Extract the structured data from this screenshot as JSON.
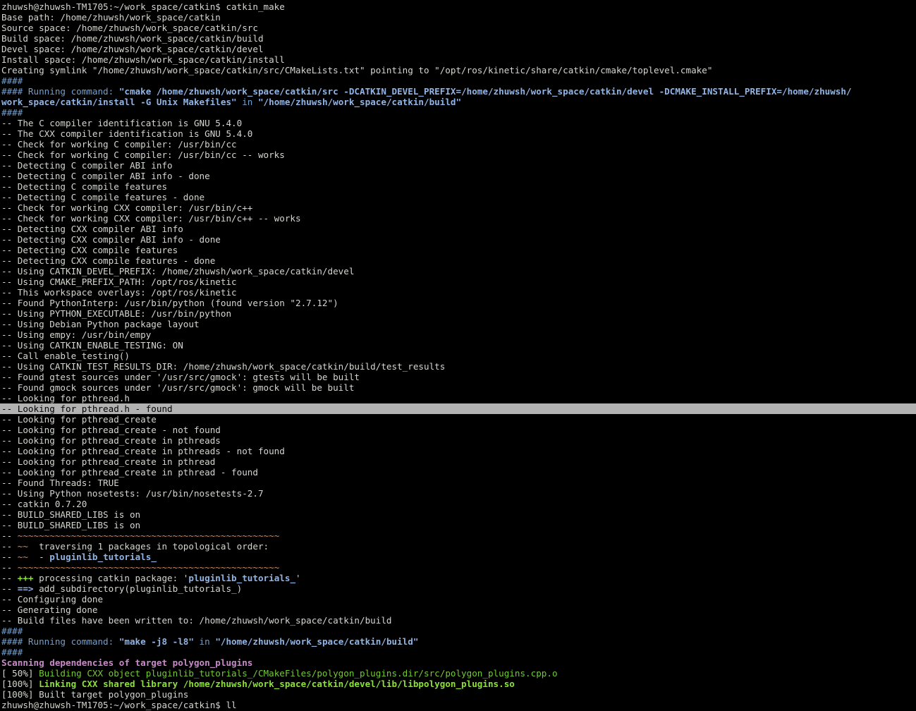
{
  "terminal": {
    "colors": {
      "background": "#000000",
      "foreground": "#d3d7cf",
      "blue": "#729fcf",
      "bluebold": "#8fb4e6",
      "green": "#73c936",
      "greenbold": "#8ae234",
      "magenta": "#c98ac9",
      "orange": "#d08a5a",
      "highlight": "#b2b2b2"
    },
    "lines": [
      {
        "segs": [
          {
            "t": "zhuwsh@zhuwsh-TM1705:~/work_space/catkin$ catkin_make"
          }
        ]
      },
      {
        "segs": [
          {
            "t": "Base path: /home/zhuwsh/work_space/catkin"
          }
        ]
      },
      {
        "segs": [
          {
            "t": "Source space: /home/zhuwsh/work_space/catkin/src"
          }
        ]
      },
      {
        "segs": [
          {
            "t": "Build space: /home/zhuwsh/work_space/catkin/build"
          }
        ]
      },
      {
        "segs": [
          {
            "t": "Devel space: /home/zhuwsh/work_space/catkin/devel"
          }
        ]
      },
      {
        "segs": [
          {
            "t": "Install space: /home/zhuwsh/work_space/catkin/install"
          }
        ]
      },
      {
        "segs": [
          {
            "t": "Creating symlink \"/home/zhuwsh/work_space/catkin/src/CMakeLists.txt\" pointing to \"/opt/ros/kinetic/share/catkin/cmake/toplevel.cmake\""
          }
        ]
      },
      {
        "segs": [
          {
            "t": "####",
            "c": "blue"
          }
        ]
      },
      {
        "segs": [
          {
            "t": "#### Running command: ",
            "c": "blue"
          },
          {
            "t": "\"cmake /home/zhuwsh/work_space/catkin/src -DCATKIN_DEVEL_PREFIX=/home/zhuwsh/work_space/catkin/devel -DCMAKE_INSTALL_PREFIX=/home/zhuwsh/",
            "c": "bluebold"
          }
        ]
      },
      {
        "segs": [
          {
            "t": "work_space/catkin/install -G Unix Makefiles\"",
            "c": "bluebold"
          },
          {
            "t": " in ",
            "c": "blue"
          },
          {
            "t": "\"/home/zhuwsh/work_space/catkin/build\"",
            "c": "bluebold"
          }
        ]
      },
      {
        "segs": [
          {
            "t": "####",
            "c": "blue"
          }
        ]
      },
      {
        "segs": [
          {
            "t": "-- The C compiler identification is GNU 5.4.0"
          }
        ]
      },
      {
        "segs": [
          {
            "t": "-- The CXX compiler identification is GNU 5.4.0"
          }
        ]
      },
      {
        "segs": [
          {
            "t": "-- Check for working C compiler: /usr/bin/cc"
          }
        ]
      },
      {
        "segs": [
          {
            "t": "-- Check for working C compiler: /usr/bin/cc -- works"
          }
        ]
      },
      {
        "segs": [
          {
            "t": "-- Detecting C compiler ABI info"
          }
        ]
      },
      {
        "segs": [
          {
            "t": "-- Detecting C compiler ABI info - done"
          }
        ]
      },
      {
        "segs": [
          {
            "t": "-- Detecting C compile features"
          }
        ]
      },
      {
        "segs": [
          {
            "t": "-- Detecting C compile features - done"
          }
        ]
      },
      {
        "segs": [
          {
            "t": "-- Check for working CXX compiler: /usr/bin/c++"
          }
        ]
      },
      {
        "segs": [
          {
            "t": "-- Check for working CXX compiler: /usr/bin/c++ -- works"
          }
        ]
      },
      {
        "segs": [
          {
            "t": "-- Detecting CXX compiler ABI info"
          }
        ]
      },
      {
        "segs": [
          {
            "t": "-- Detecting CXX compiler ABI info - done"
          }
        ]
      },
      {
        "segs": [
          {
            "t": "-- Detecting CXX compile features"
          }
        ]
      },
      {
        "segs": [
          {
            "t": "-- Detecting CXX compile features - done"
          }
        ]
      },
      {
        "segs": [
          {
            "t": "-- Using CATKIN_DEVEL_PREFIX: /home/zhuwsh/work_space/catkin/devel"
          }
        ]
      },
      {
        "segs": [
          {
            "t": "-- Using CMAKE_PREFIX_PATH: /opt/ros/kinetic"
          }
        ]
      },
      {
        "segs": [
          {
            "t": "-- This workspace overlays: /opt/ros/kinetic"
          }
        ]
      },
      {
        "segs": [
          {
            "t": "-- Found PythonInterp: /usr/bin/python (found version \"2.7.12\")"
          }
        ]
      },
      {
        "segs": [
          {
            "t": "-- Using PYTHON_EXECUTABLE: /usr/bin/python"
          }
        ]
      },
      {
        "segs": [
          {
            "t": "-- Using Debian Python package layout"
          }
        ]
      },
      {
        "segs": [
          {
            "t": "-- Using empy: /usr/bin/empy"
          }
        ]
      },
      {
        "segs": [
          {
            "t": "-- Using CATKIN_ENABLE_TESTING: ON"
          }
        ]
      },
      {
        "segs": [
          {
            "t": "-- Call enable_testing()"
          }
        ]
      },
      {
        "segs": [
          {
            "t": "-- Using CATKIN_TEST_RESULTS_DIR: /home/zhuwsh/work_space/catkin/build/test_results"
          }
        ]
      },
      {
        "segs": [
          {
            "t": "-- Found gtest sources under '/usr/src/gmock': gtests will be built"
          }
        ]
      },
      {
        "segs": [
          {
            "t": "-- Found gmock sources under '/usr/src/gmock': gmock will be built"
          }
        ]
      },
      {
        "segs": [
          {
            "t": "-- Looking for pthread.h"
          }
        ]
      },
      {
        "hl": true,
        "segs": [
          {
            "t": "-- Looking for pthread.h - found",
            "c": "hltext"
          }
        ]
      },
      {
        "segs": [
          {
            "t": "-- Looking for pthread_create"
          }
        ]
      },
      {
        "segs": [
          {
            "t": "-- Looking for pthread_create - not found"
          }
        ]
      },
      {
        "segs": [
          {
            "t": "-- Looking for pthread_create in pthreads"
          }
        ]
      },
      {
        "segs": [
          {
            "t": "-- Looking for pthread_create in pthreads - not found"
          }
        ]
      },
      {
        "segs": [
          {
            "t": "-- Looking for pthread_create in pthread"
          }
        ]
      },
      {
        "segs": [
          {
            "t": "-- Looking for pthread_create in pthread - found"
          }
        ]
      },
      {
        "segs": [
          {
            "t": "-- Found Threads: TRUE"
          }
        ]
      },
      {
        "segs": [
          {
            "t": "-- Using Python nosetests: /usr/bin/nosetests-2.7"
          }
        ]
      },
      {
        "segs": [
          {
            "t": "-- catkin 0.7.20"
          }
        ]
      },
      {
        "segs": [
          {
            "t": "-- BUILD_SHARED_LIBS is on"
          }
        ]
      },
      {
        "segs": [
          {
            "t": "-- BUILD_SHARED_LIBS is on"
          }
        ]
      },
      {
        "segs": [
          {
            "t": "-- "
          },
          {
            "t": "~~~~~~~~~~~~~~~~~~~~~~~~~~~~~~~~~~~~~~~~~~~~~~~~~",
            "c": "orange"
          }
        ]
      },
      {
        "segs": [
          {
            "t": "-- "
          },
          {
            "t": "~~",
            "c": "orange"
          },
          {
            "t": "  traversing 1 packages in topological order:"
          }
        ]
      },
      {
        "segs": [
          {
            "t": "-- "
          },
          {
            "t": "~~",
            "c": "orange"
          },
          {
            "t": "  - "
          },
          {
            "t": "pluginlib_tutorials_",
            "c": "bluebold"
          }
        ]
      },
      {
        "segs": [
          {
            "t": "-- "
          },
          {
            "t": "~~~~~~~~~~~~~~~~~~~~~~~~~~~~~~~~~~~~~~~~~~~~~~~~~",
            "c": "orange"
          }
        ]
      },
      {
        "segs": [
          {
            "t": "-- "
          },
          {
            "t": "+++",
            "c": "greenbold"
          },
          {
            "t": " processing catkin package: '"
          },
          {
            "t": "pluginlib_tutorials_",
            "c": "bluebold"
          },
          {
            "t": "'"
          }
        ]
      },
      {
        "segs": [
          {
            "t": "-- "
          },
          {
            "t": "==>",
            "c": "bluebold"
          },
          {
            "t": " add_subdirectory(pluginlib_tutorials_)"
          }
        ]
      },
      {
        "segs": [
          {
            "t": "-- Configuring done"
          }
        ]
      },
      {
        "segs": [
          {
            "t": "-- Generating done"
          }
        ]
      },
      {
        "segs": [
          {
            "t": "-- Build files have been written to: /home/zhuwsh/work_space/catkin/build"
          }
        ]
      },
      {
        "segs": [
          {
            "t": "####",
            "c": "blue"
          }
        ]
      },
      {
        "segs": [
          {
            "t": "#### Running command: ",
            "c": "blue"
          },
          {
            "t": "\"make -j8 -l8\"",
            "c": "bluebold"
          },
          {
            "t": " in ",
            "c": "blue"
          },
          {
            "t": "\"/home/zhuwsh/work_space/catkin/build\"",
            "c": "bluebold"
          }
        ]
      },
      {
        "segs": [
          {
            "t": "####",
            "c": "blue"
          }
        ]
      },
      {
        "segs": [
          {
            "t": "Scanning dependencies of target polygon_plugins",
            "c": "magentabold"
          }
        ]
      },
      {
        "segs": [
          {
            "t": "[ 50%] "
          },
          {
            "t": "Building CXX object pluginlib_tutorials_/CMakeFiles/polygon_plugins.dir/src/polygon_plugins.cpp.o",
            "c": "green"
          }
        ]
      },
      {
        "segs": [
          {
            "t": "[100%] "
          },
          {
            "t": "Linking CXX shared library /home/zhuwsh/work_space/catkin/devel/lib/libpolygon_plugins.so",
            "c": "greenbold"
          }
        ]
      },
      {
        "segs": [
          {
            "t": "[100%] Built target polygon_plugins"
          }
        ]
      },
      {
        "segs": [
          {
            "t": "zhuwsh@zhuwsh-TM1705:~/work_space/catkin$ ll"
          }
        ]
      }
    ]
  }
}
